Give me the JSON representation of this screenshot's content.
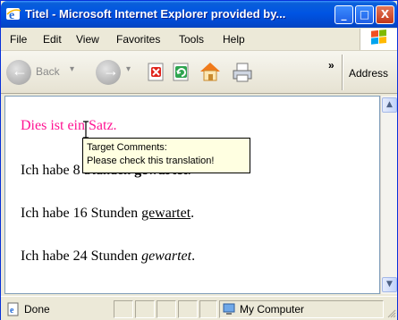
{
  "window": {
    "title": "Titel - Microsoft Internet Explorer provided by...",
    "minimize_glyph": "_",
    "maximize_glyph": "□",
    "close_glyph": "X"
  },
  "menubar": {
    "items": [
      "File",
      "Edit",
      "View",
      "Favorites",
      "Tools",
      "Help"
    ]
  },
  "toolbar": {
    "back_label": "Back",
    "dropdown_glyph": "▾",
    "chevron": "»",
    "address_label": "Address"
  },
  "content": {
    "line1": "Dies ist ein Satz.",
    "line2_prefix": "Ich habe 8 Stunden ",
    "line2_word": "gewartet",
    "line2_suffix": ".",
    "line3_prefix": "Ich habe 16 Stunden ",
    "line3_word": "gewartet",
    "line3_suffix": ".",
    "line4_prefix": "Ich habe 24 Stunden ",
    "line4_word": "gewartet",
    "line4_suffix": "."
  },
  "tooltip": {
    "line1": "Target Comments:",
    "line2": "Please check this translation!"
  },
  "statusbar": {
    "status": "Done",
    "zone": "My Computer"
  },
  "colors": {
    "title_bar": "#0054e3",
    "first_line_text": "#ff1493",
    "tooltip_bg": "#ffffe1",
    "chrome": "#ece9d8"
  },
  "icons": {
    "title": "ie-logo-icon",
    "back": "back-arrow-icon",
    "forward": "forward-arrow-icon",
    "stop": "stop-icon",
    "refresh": "refresh-icon",
    "home": "home-icon",
    "print": "print-icon",
    "status": "ie-page-icon",
    "zone": "my-computer-icon"
  }
}
